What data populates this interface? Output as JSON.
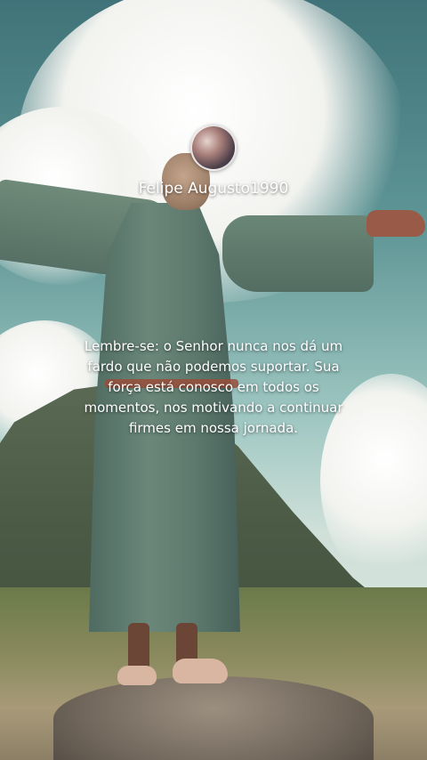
{
  "post": {
    "username": "Felipe Augusto1990",
    "quote": "Lembre-se: o Senhor nunca nos dá um\nfardo que não podemos suportar. Sua\nforça está conosco em todos os\nmomentos, nos motivando a continuar\nfirmes em nossa jornada."
  },
  "icons": {
    "avatar": "profile-avatar"
  },
  "colors": {
    "text": "#ffffff",
    "sky": "#5f9696"
  }
}
